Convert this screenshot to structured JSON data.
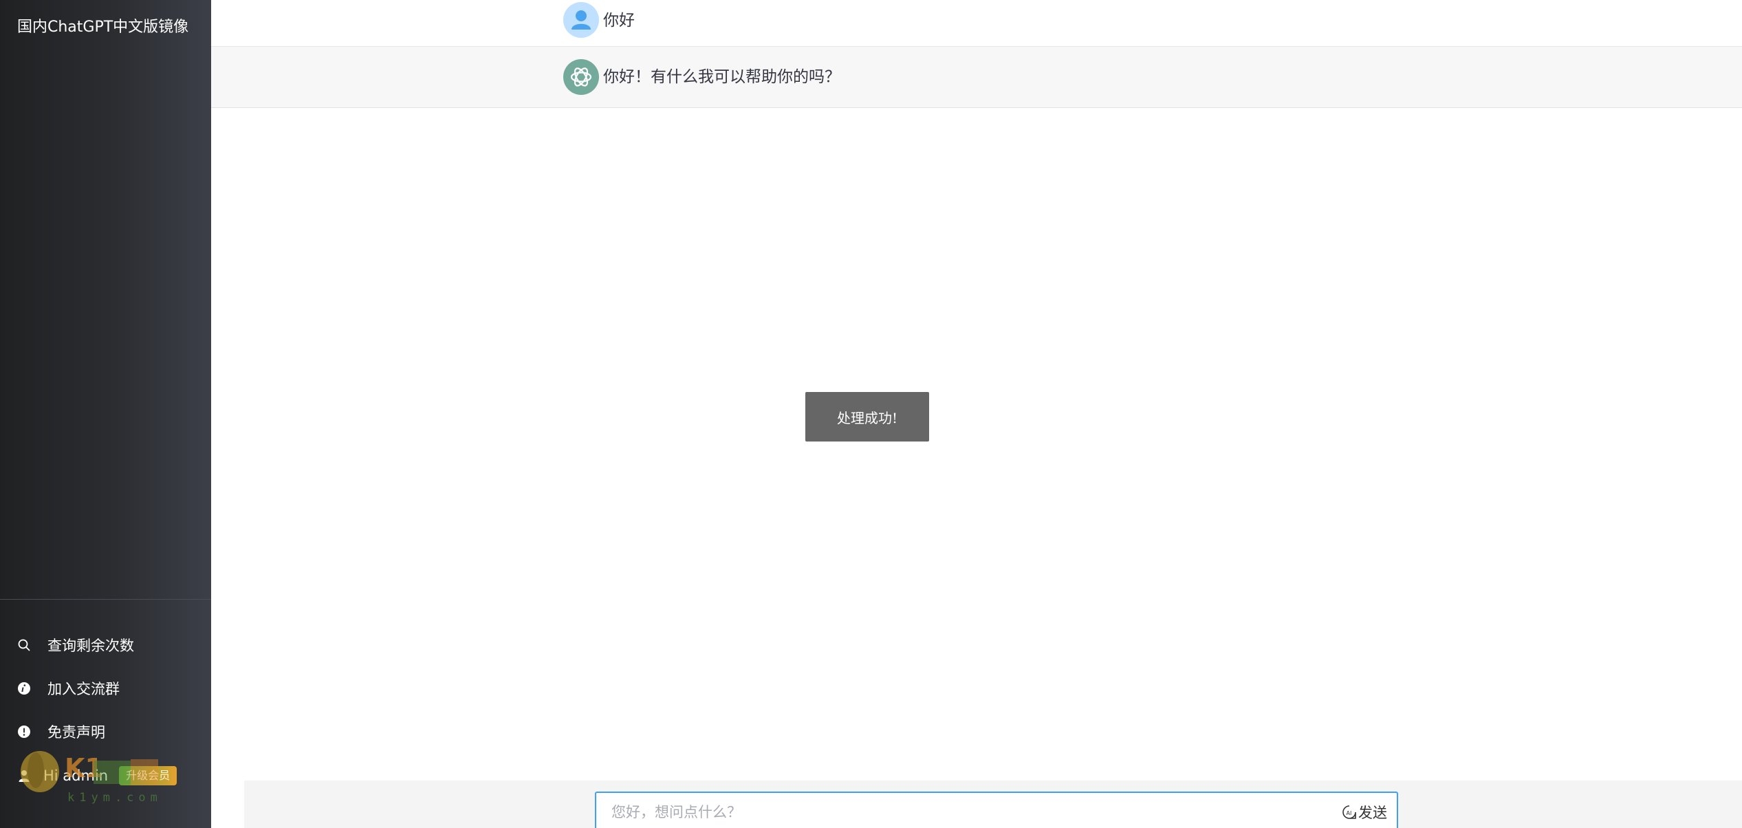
{
  "sidebar": {
    "title": "国内ChatGPT中文版镜像",
    "items": [
      {
        "label": "查询剩余次数",
        "icon": "search-icon"
      },
      {
        "label": "加入交流群",
        "icon": "info-icon"
      },
      {
        "label": "免责声明",
        "icon": "warning-icon"
      }
    ],
    "user": {
      "greeting": "Hi admin",
      "icon": "user-icon",
      "badge": "升级会员"
    },
    "watermark": {
      "logo_text": "K1",
      "domain_text": "k1ym.com"
    }
  },
  "chat": {
    "messages": [
      {
        "role": "user",
        "text": "你好",
        "avatar": "user-avatar"
      },
      {
        "role": "assistant",
        "text": "你好！有什么我可以帮助你的吗？",
        "avatar": "chatgpt-logo-avatar"
      }
    ]
  },
  "toast": {
    "text": "处理成功!"
  },
  "composer": {
    "placeholder": "您好，想问点什么？",
    "value": "",
    "send_label": "发送",
    "send_icon": "ai-send-icon"
  },
  "colors": {
    "sidebar_start": "#202123",
    "sidebar_end": "#3c3f48",
    "input_focus_border": "#409eff",
    "bot_row_bg": "#f7f7f8",
    "chatgpt_green": "#74aa9c",
    "user_avatar_bg": "#bfe0ff",
    "toast_bg": "#666666"
  }
}
